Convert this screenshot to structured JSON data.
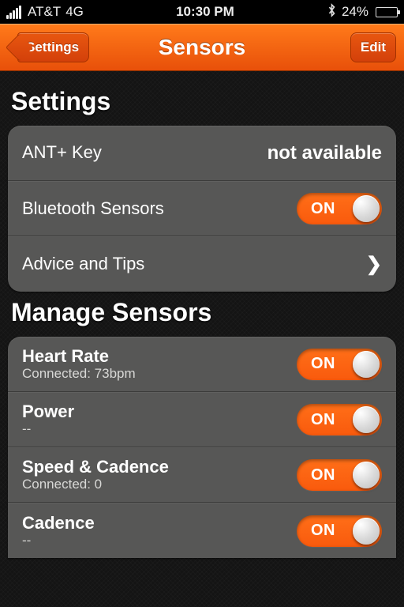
{
  "status_bar": {
    "carrier": "AT&T",
    "network": "4G",
    "time": "10:30 PM",
    "battery_pct": "24%"
  },
  "navbar": {
    "back_label": "Settings",
    "title": "Sensors",
    "right_label": "Edit"
  },
  "sections": {
    "settings": {
      "title": "Settings",
      "ant_key_label": "ANT+ Key",
      "ant_key_value": "not available",
      "bluetooth_label": "Bluetooth Sensors",
      "bluetooth_toggle": "ON",
      "advice_label": "Advice and Tips"
    },
    "manage": {
      "title": "Manage Sensors",
      "items": [
        {
          "name": "Heart Rate",
          "sub": "Connected: 73bpm",
          "toggle": "ON"
        },
        {
          "name": "Power",
          "sub": "--",
          "toggle": "ON"
        },
        {
          "name": "Speed & Cadence",
          "sub": "Connected: 0",
          "toggle": "ON"
        },
        {
          "name": "Cadence",
          "sub": "--",
          "toggle": "ON"
        }
      ]
    }
  }
}
